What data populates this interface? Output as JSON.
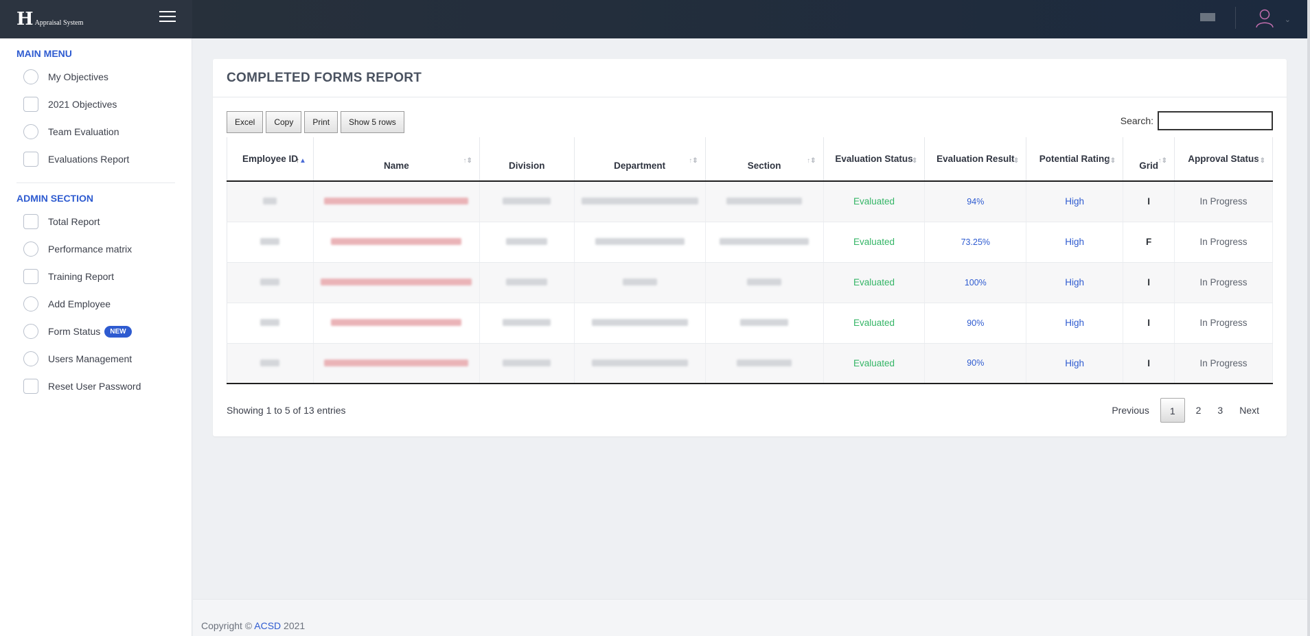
{
  "brand": {
    "mark": "H",
    "text": "Appraisal System"
  },
  "sidebar": {
    "main_title": "MAIN MENU",
    "main_items": [
      {
        "label": "My Objectives"
      },
      {
        "label": "2021 Objectives"
      },
      {
        "label": "Team Evaluation"
      },
      {
        "label": "Evaluations Report"
      }
    ],
    "admin_title": "ADMIN SECTION",
    "admin_items": [
      {
        "label": "Total Report"
      },
      {
        "label": "Performance matrix"
      },
      {
        "label": "Training Report"
      },
      {
        "label": "Add Employee"
      },
      {
        "label": "Form Status",
        "badge": "NEW"
      },
      {
        "label": "Users Management"
      },
      {
        "label": "Reset User Password"
      }
    ]
  },
  "report": {
    "title": "COMPLETED FORMS REPORT",
    "buttons": {
      "excel": "Excel",
      "copy": "Copy",
      "print": "Print",
      "show_rows": "Show 5 rows"
    },
    "search_label": "Search:",
    "search_value": "",
    "columns": [
      "Employee ID",
      "Name",
      "Division",
      "Department",
      "Section",
      "Evaluation Status",
      "Evaluation Result",
      "Potential Rating",
      "Grid",
      "Approval Status"
    ],
    "rows": [
      {
        "status": "Evaluated",
        "result": "94%",
        "rating": "High",
        "grid": "I",
        "approval": "In Progress"
      },
      {
        "status": "Evaluated",
        "result": "73.25%",
        "rating": "High",
        "grid": "F",
        "approval": "In Progress"
      },
      {
        "status": "Evaluated",
        "result": "100%",
        "rating": "High",
        "grid": "I",
        "approval": "In Progress"
      },
      {
        "status": "Evaluated",
        "result": "90%",
        "rating": "High",
        "grid": "I",
        "approval": "In Progress"
      },
      {
        "status": "Evaluated",
        "result": "90%",
        "rating": "High",
        "grid": "I",
        "approval": "In Progress"
      }
    ],
    "entries_info": "Showing 1 to 5 of 13 entries",
    "pagination": {
      "previous": "Previous",
      "pages": [
        "1",
        "2",
        "3"
      ],
      "current": "1",
      "next": "Next"
    }
  },
  "footer": {
    "prefix": "Copyright ©",
    "link": "ACSD",
    "year": "2021"
  },
  "colors": {
    "accent": "#2e5bd0",
    "evaluated": "#34b566",
    "header_dark": "#1c2a3e"
  }
}
